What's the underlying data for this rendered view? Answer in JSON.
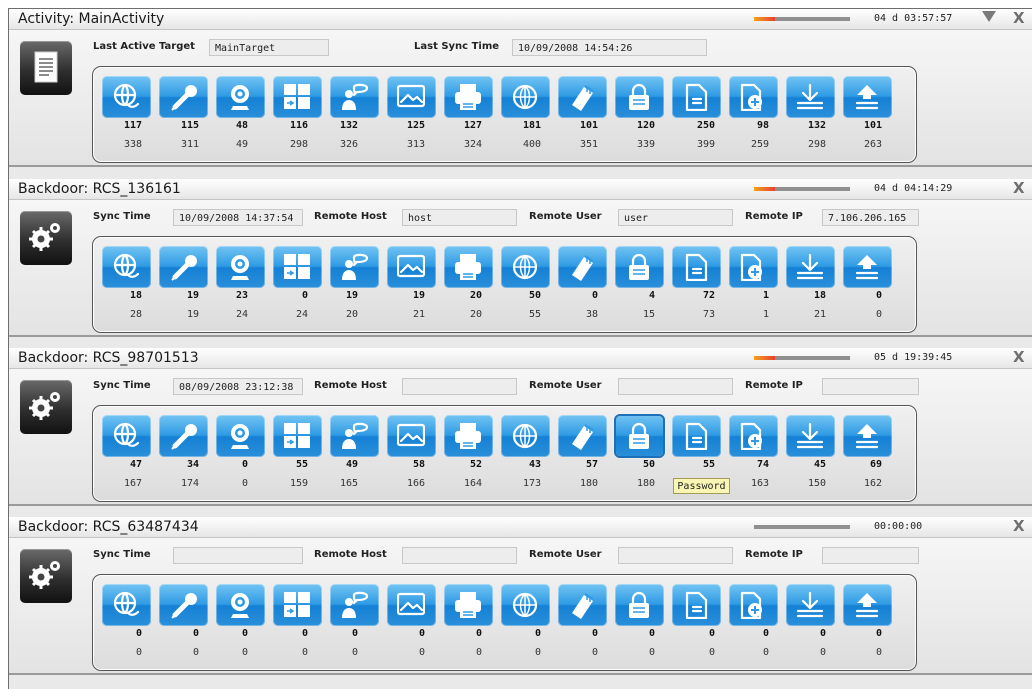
{
  "colors": {
    "button_blue": "#2f9be4",
    "panel_bg": "#e9e9e9",
    "tooltip_bg": "#f9f6b4",
    "progress": "#e8412a"
  },
  "panels": [
    {
      "type": "activity",
      "title": "Activity: MainActivity",
      "timer": "04 d 03:57:57",
      "progress": 0.22,
      "has_minimize": true,
      "fields": [
        {
          "label": "Last Active Target",
          "value": "MainTarget"
        },
        {
          "label": "Last Sync Time",
          "value": "10/09/2008 14:54:26"
        }
      ],
      "counts_top": [
        "117",
        "115",
        "48",
        "116",
        "132",
        "125",
        "127",
        "181",
        "101",
        "120",
        "250",
        "98",
        "132",
        "101"
      ],
      "counts_bottom": [
        "338",
        "311",
        "49",
        "298",
        "326",
        "313",
        "324",
        "400",
        "351",
        "339",
        "399",
        "259",
        "298",
        "263"
      ]
    },
    {
      "type": "backdoor",
      "title": "Backdoor: RCS_136161",
      "timer": "04 d 04:14:29",
      "progress": 0.22,
      "has_minimize": false,
      "fields": [
        {
          "label": "Sync Time",
          "value": "10/09/2008 14:37:54"
        },
        {
          "label": "Remote Host",
          "value": "host"
        },
        {
          "label": "Remote User",
          "value": "user"
        },
        {
          "label": "Remote IP",
          "value": "7.106.206.165"
        }
      ],
      "counts_top": [
        "18",
        "19",
        "23",
        "0",
        "19",
        "19",
        "20",
        "50",
        "0",
        "4",
        "72",
        "1",
        "18",
        "0"
      ],
      "counts_bottom": [
        "28",
        "19",
        "24",
        "24",
        "20",
        "21",
        "20",
        "55",
        "38",
        "15",
        "73",
        "1",
        "21",
        "0"
      ]
    },
    {
      "type": "backdoor",
      "title": "Backdoor: RCS_98701513",
      "timer": "05 d 19:39:45",
      "progress": 0.22,
      "has_minimize": false,
      "fields": [
        {
          "label": "Sync Time",
          "value": "08/09/2008 23:12:38"
        },
        {
          "label": "Remote Host",
          "value": ""
        },
        {
          "label": "Remote User",
          "value": ""
        },
        {
          "label": "Remote IP",
          "value": ""
        }
      ],
      "counts_top": [
        "47",
        "34",
        "0",
        "55",
        "49",
        "58",
        "52",
        "43",
        "57",
        "50",
        "55",
        "74",
        "45",
        "69"
      ],
      "counts_bottom": [
        "167",
        "174",
        "0",
        "159",
        "165",
        "166",
        "164",
        "173",
        "180",
        "180",
        "",
        "163",
        "150",
        "162"
      ]
    },
    {
      "type": "backdoor",
      "title": "Backdoor: RCS_63487434",
      "timer": "00:00:00",
      "progress": 0,
      "has_minimize": false,
      "fields": [
        {
          "label": "Sync Time",
          "value": ""
        },
        {
          "label": "Remote Host",
          "value": ""
        },
        {
          "label": "Remote User",
          "value": ""
        },
        {
          "label": "Remote IP",
          "value": ""
        }
      ],
      "counts_top": [
        "0",
        "0",
        "0",
        "0",
        "0",
        "0",
        "0",
        "0",
        "0",
        "0",
        "0",
        "0",
        "0",
        "0"
      ],
      "counts_bottom": [
        "0",
        "0",
        "0",
        "0",
        "0",
        "0",
        "0",
        "0",
        "0",
        "0",
        "0",
        "0",
        "0",
        "0"
      ]
    }
  ],
  "module_icons": [
    "globe-chat-icon",
    "microphone-icon",
    "webcam-icon",
    "keyboard-icon",
    "user-chat-icon",
    "screenshot-icon",
    "printer-icon",
    "internet-icon",
    "device-icon",
    "lock-icon",
    "document-icon",
    "file-add-icon",
    "download-icon",
    "upload-icon"
  ],
  "tooltip": {
    "text": "Password"
  }
}
